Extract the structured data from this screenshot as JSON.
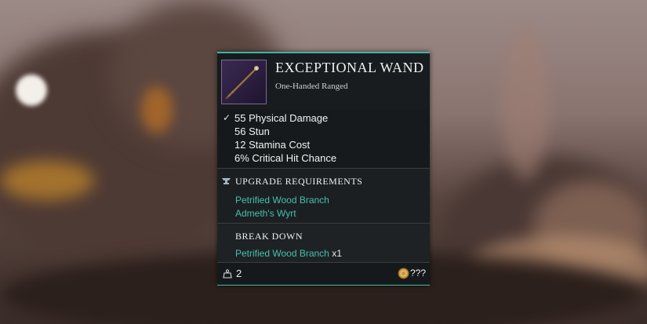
{
  "item": {
    "name": "EXCEPTIONAL WAND",
    "type": "One-Handed Ranged",
    "icon": "wand-icon"
  },
  "stats": [
    "55 Physical Damage",
    "56 Stun",
    "12 Stamina Cost",
    "6% Critical Hit Chance"
  ],
  "upgrade": {
    "title": "UPGRADE REQUIREMENTS",
    "icon": "anvil-icon",
    "materials": [
      "Petrified Wood Branch",
      "Admeth's Wyrt"
    ]
  },
  "breakdown": {
    "title": "BREAK DOWN",
    "material": "Petrified Wood Branch",
    "quantity": "x1"
  },
  "footer": {
    "weight": "2",
    "weight_icon": "weight-icon",
    "value": "???",
    "value_icon": "coin-icon"
  },
  "colors": {
    "accent": "#3fb3a3",
    "material_text": "#43c2ad",
    "panel_bg": "#1e2124"
  }
}
